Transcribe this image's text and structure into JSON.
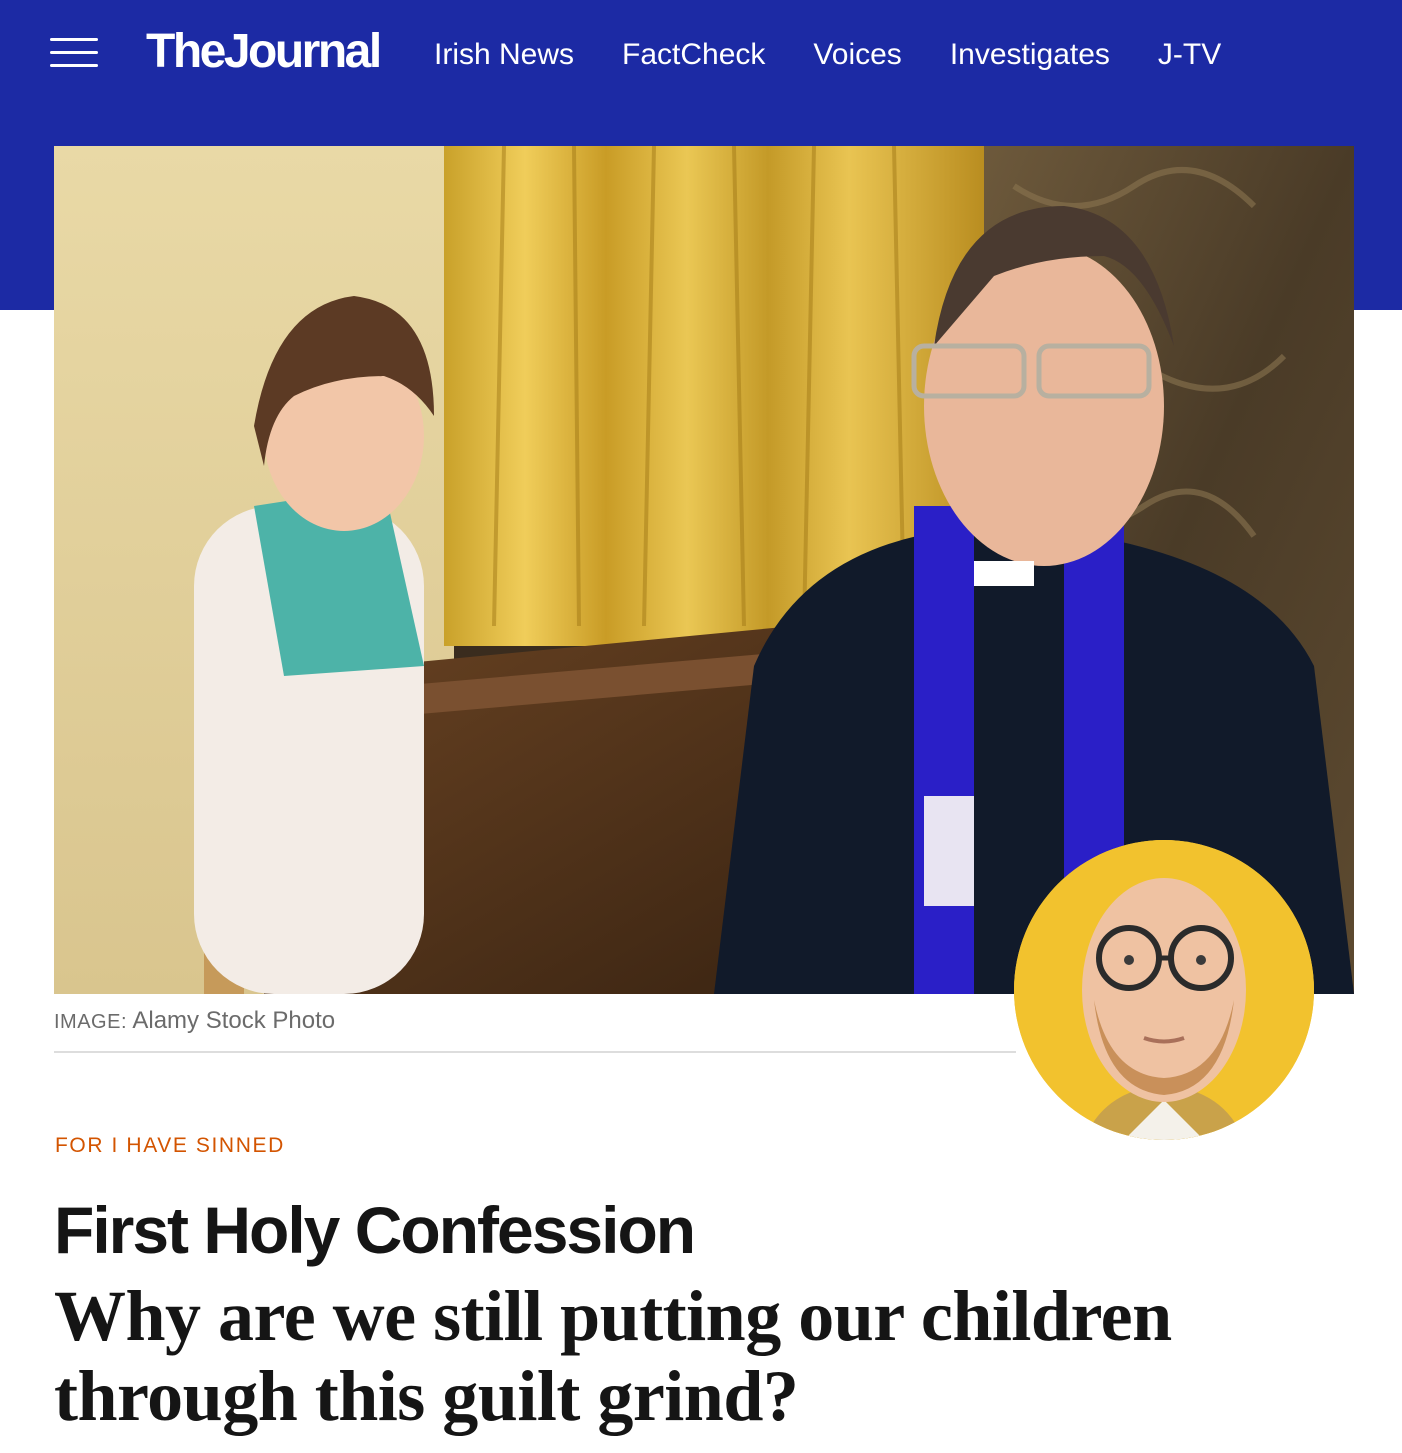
{
  "header": {
    "brand_color": "#1c2aa4",
    "menu_icon": "hamburger-menu-icon",
    "logo_text": "TheJournal",
    "nav": [
      {
        "label": "Irish News"
      },
      {
        "label": "FactCheck"
      },
      {
        "label": "Voices"
      },
      {
        "label": "Investigates"
      },
      {
        "label": "J-TV"
      }
    ]
  },
  "hero": {
    "caption_label": "IMAGE:",
    "caption_credit": "Alamy Stock Photo"
  },
  "author": {
    "avatar_bg": "#f2c22e"
  },
  "article": {
    "kicker": "FOR I HAVE SINNED",
    "kicker_color": "#d35400",
    "headline": "First Holy Confession",
    "subheadline": "Why are we still putting our children through this guilt grind?"
  }
}
